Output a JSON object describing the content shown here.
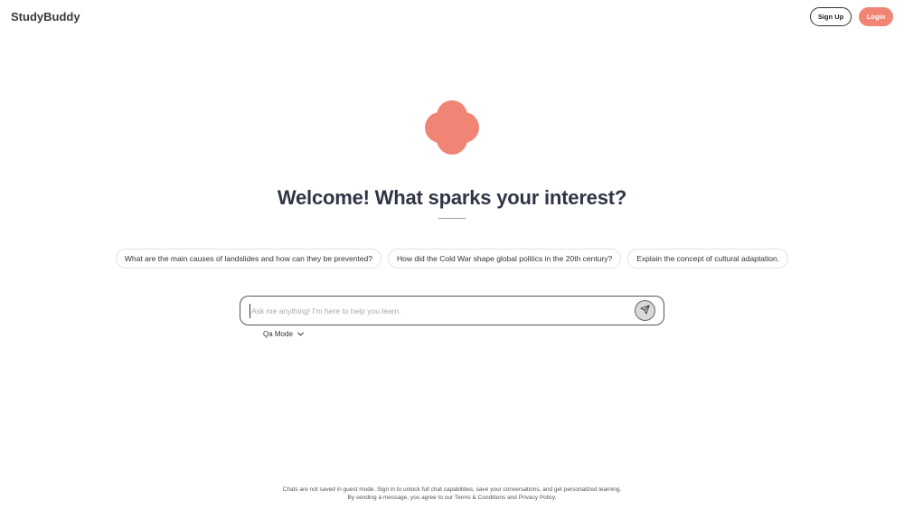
{
  "header": {
    "brand": "StudyBuddy",
    "signup_label": "Sign Up",
    "login_label": "Login",
    "accent_color": "#f08576"
  },
  "logo": {
    "icon": "clover-logo-icon",
    "color": "#f08576"
  },
  "main": {
    "welcome": "Welcome! What sparks your interest?",
    "suggestions": [
      "What are the main causes of landslides and how can they be prevented?",
      "How did the Cold War shape global politics in the 20th century?",
      "Explain the concept of cultural adaptation."
    ]
  },
  "chat": {
    "placeholder": "Ask me anything! I'm here to help you learn.",
    "value": "",
    "send_icon": "send-icon",
    "mode_label": "Qa Mode",
    "mode_icon": "chevron-down-icon"
  },
  "footer": {
    "line1": "Chats are not saved in guest mode. Sign in to unlock full chat capabilities, save your conversations, and get personalized learning.",
    "line2": "By sending a message, you agree to our Terms & Conditions and Privacy Policy."
  }
}
